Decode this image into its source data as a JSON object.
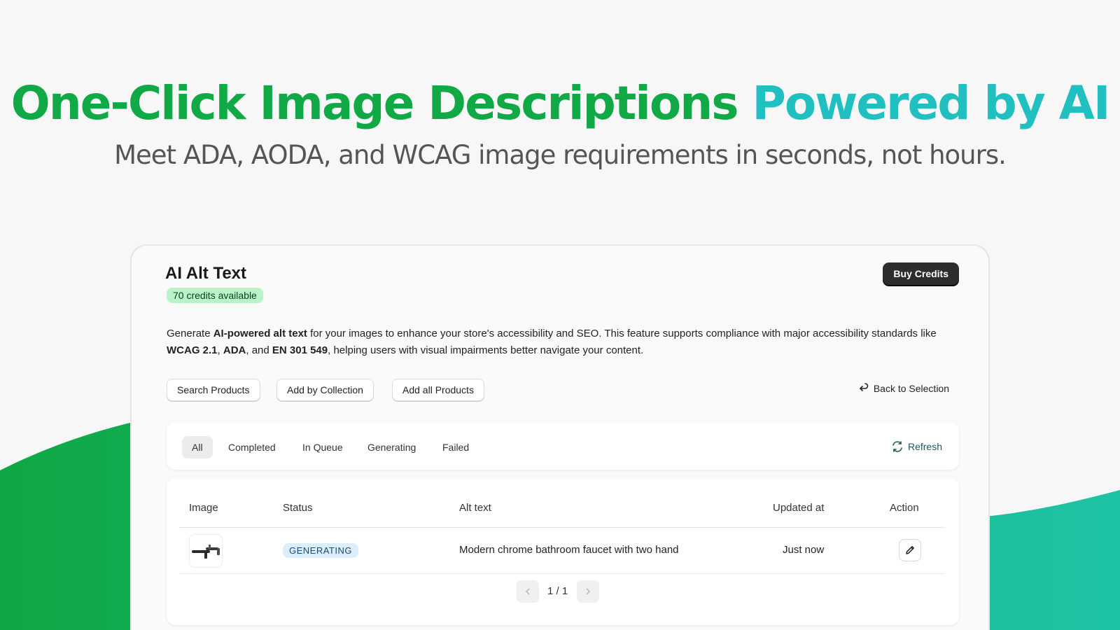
{
  "hero": {
    "title_part1": "One-Click Image Descriptions",
    "title_part2": "Powered by AI",
    "subtitle": "Meet ADA, AODA, and WCAG image requirements in seconds, not hours."
  },
  "app": {
    "title": "AI Alt Text",
    "credits_badge": "70 credits available",
    "buy_credits_label": "Buy Credits"
  },
  "description": {
    "t1": "Generate ",
    "b1": "AI-powered alt text",
    "t2": " for your images to enhance your store's accessibility and SEO. This feature supports compliance with major accessibility standards like ",
    "b2": "WCAG 2.1",
    "t3": ", ",
    "b3": "ADA",
    "t4": ", and ",
    "b4": "EN 301 549",
    "t5": ", helping users with visual impairments better navigate your content."
  },
  "actions": {
    "search_products": "Search Products",
    "add_by_collection": "Add by Collection",
    "add_all_products": "Add all Products",
    "back_to_selection": "Back to Selection"
  },
  "tabs": [
    {
      "label": "All",
      "active": true
    },
    {
      "label": "Completed",
      "active": false
    },
    {
      "label": "In Queue",
      "active": false
    },
    {
      "label": "Generating",
      "active": false
    },
    {
      "label": "Failed",
      "active": false
    }
  ],
  "refresh_label": "Refresh",
  "table": {
    "columns": [
      "Image",
      "Status",
      "Alt text",
      "Updated at",
      "Action"
    ],
    "rows": [
      {
        "image_icon": "faucet-thumbnail-icon",
        "status": "GENERATING",
        "alt_text": "Modern chrome bathroom faucet with two hand",
        "updated_at": "Just now"
      }
    ]
  },
  "pagination": {
    "text": "1 / 1"
  },
  "colors": {
    "title_green": "#11a945",
    "title_teal": "#20bfc0",
    "wave_green": "#0fa844",
    "wave_teal": "#1ec3a6",
    "credits_badge_bg": "#b7f5c8",
    "status_badge_bg": "#dbeefc",
    "buy_button_bg": "#2d2d2d"
  }
}
